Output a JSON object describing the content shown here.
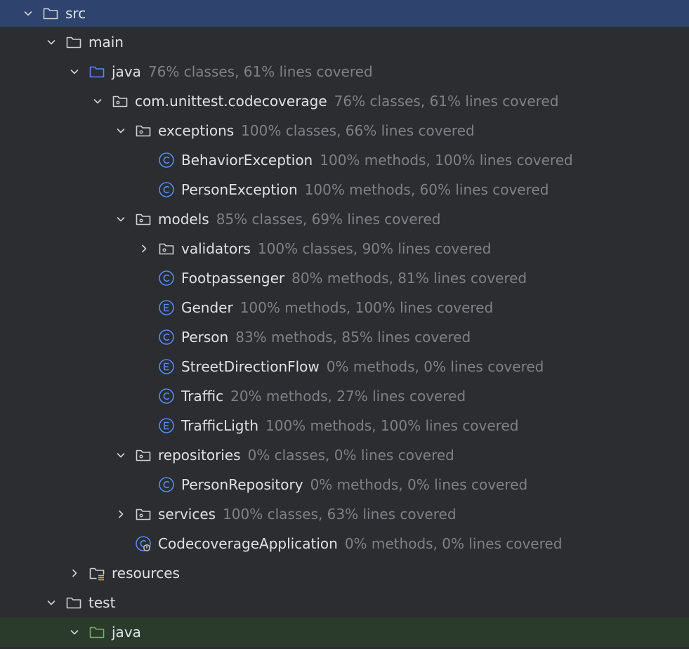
{
  "tree": [
    {
      "name": "src",
      "stats": "",
      "indent": 0,
      "expand": "down",
      "icon": "folder-icon",
      "selected": true
    },
    {
      "name": "main",
      "stats": "",
      "indent": 1,
      "expand": "down",
      "icon": "folder-icon"
    },
    {
      "name": "java",
      "stats": "76% classes, 61% lines covered",
      "indent": 2,
      "expand": "down",
      "icon": "source-folder-icon"
    },
    {
      "name": "com.unittest.codecoverage",
      "stats": "76% classes, 61% lines covered",
      "indent": 3,
      "expand": "down",
      "icon": "package-icon"
    },
    {
      "name": "exceptions",
      "stats": "100% classes, 66% lines covered",
      "indent": 4,
      "expand": "down",
      "icon": "package-icon"
    },
    {
      "name": "BehaviorException",
      "stats": "100% methods, 100% lines covered",
      "indent": 5,
      "expand": "none",
      "icon": "class-icon"
    },
    {
      "name": "PersonException",
      "stats": "100% methods, 60% lines covered",
      "indent": 5,
      "expand": "none",
      "icon": "class-icon"
    },
    {
      "name": "models",
      "stats": "85% classes, 69% lines covered",
      "indent": 4,
      "expand": "down",
      "icon": "package-icon"
    },
    {
      "name": "validators",
      "stats": "100% classes, 90% lines covered",
      "indent": 5,
      "expand": "right",
      "icon": "package-icon"
    },
    {
      "name": "Footpassenger",
      "stats": "80% methods, 81% lines covered",
      "indent": 5,
      "expand": "none",
      "icon": "class-icon"
    },
    {
      "name": "Gender",
      "stats": "100% methods, 100% lines covered",
      "indent": 5,
      "expand": "none",
      "icon": "enum-icon"
    },
    {
      "name": "Person",
      "stats": "83% methods, 85% lines covered",
      "indent": 5,
      "expand": "none",
      "icon": "class-icon"
    },
    {
      "name": "StreetDirectionFlow",
      "stats": "0% methods, 0% lines covered",
      "indent": 5,
      "expand": "none",
      "icon": "enum-icon"
    },
    {
      "name": "Traffic",
      "stats": "20% methods, 27% lines covered",
      "indent": 5,
      "expand": "none",
      "icon": "class-icon"
    },
    {
      "name": "TrafficLigth",
      "stats": "100% methods, 100% lines covered",
      "indent": 5,
      "expand": "none",
      "icon": "enum-icon"
    },
    {
      "name": "repositories",
      "stats": "0% classes, 0% lines covered",
      "indent": 4,
      "expand": "down",
      "icon": "package-icon"
    },
    {
      "name": "PersonRepository",
      "stats": "0% methods, 0% lines covered",
      "indent": 5,
      "expand": "none",
      "icon": "class-icon"
    },
    {
      "name": "services",
      "stats": "100% classes, 63% lines covered",
      "indent": 4,
      "expand": "right",
      "icon": "package-icon"
    },
    {
      "name": "CodecoverageApplication",
      "stats": "0% methods, 0% lines covered",
      "indent": 4,
      "expand": "none",
      "icon": "spring-class-icon"
    },
    {
      "name": "resources",
      "stats": "",
      "indent": 2,
      "expand": "right",
      "icon": "resources-folder-icon"
    },
    {
      "name": "test",
      "stats": "",
      "indent": 1,
      "expand": "down",
      "icon": "folder-icon"
    },
    {
      "name": "java",
      "stats": "",
      "indent": 2,
      "expand": "down",
      "icon": "test-source-folder-icon",
      "test": true
    }
  ],
  "colors": {
    "background": "#2b2d30",
    "selection": "#2e436e",
    "test_row": "#2a3b2c",
    "text": "#dfe1e5",
    "muted": "#7e8188",
    "source_folder": "#548af7",
    "test_folder": "#5fb865",
    "class_icon": "#548af7"
  }
}
